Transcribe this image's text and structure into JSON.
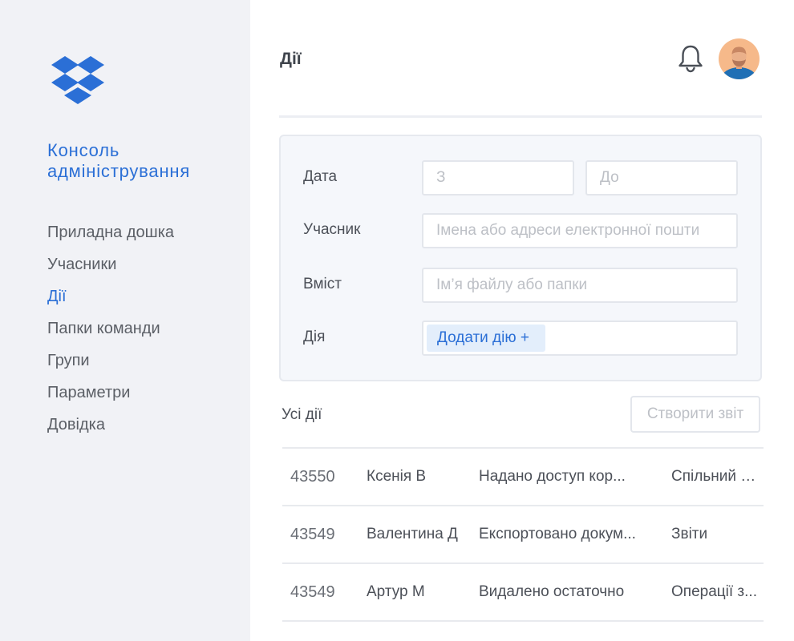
{
  "sidebar": {
    "console_title": "Консоль адміністрування",
    "items": [
      {
        "label": "Приладна дошка"
      },
      {
        "label": "Учасники"
      },
      {
        "label": "Дії"
      },
      {
        "label": "Папки команди"
      },
      {
        "label": "Групи"
      },
      {
        "label": "Параметри"
      },
      {
        "label": "Довідка"
      }
    ],
    "active_index": 2
  },
  "header": {
    "title": "Дії",
    "notification_icon": "bell-icon",
    "avatar_icon": "user-avatar"
  },
  "filters": {
    "date_label": "Дата",
    "date_from_placeholder": "З",
    "date_to_placeholder": "До",
    "member_label": "Учасник",
    "member_placeholder": "Імена або адреси електронної пошти",
    "content_label": "Вміст",
    "content_placeholder": "Ім’я файлу або папки",
    "action_label": "Дія",
    "add_action_label": "Додати дію +"
  },
  "list": {
    "title": "Усі дії",
    "report_button": "Створити звіт",
    "rows": [
      {
        "id": "43550",
        "member": "Ксенія В",
        "action": "Надано доступ кор...",
        "category": "Спільний д..."
      },
      {
        "id": "43549",
        "member": "Валентина Д",
        "action": "Експортовано докум...",
        "category": "Звіти"
      },
      {
        "id": "43549",
        "member": "Артур М",
        "action": "Видалено остаточно",
        "category": "Операції з..."
      }
    ]
  },
  "colors": {
    "accent": "#2b6fd6",
    "sidebar_bg": "#f1f2f6",
    "panel_bg": "#f5f7fb"
  }
}
